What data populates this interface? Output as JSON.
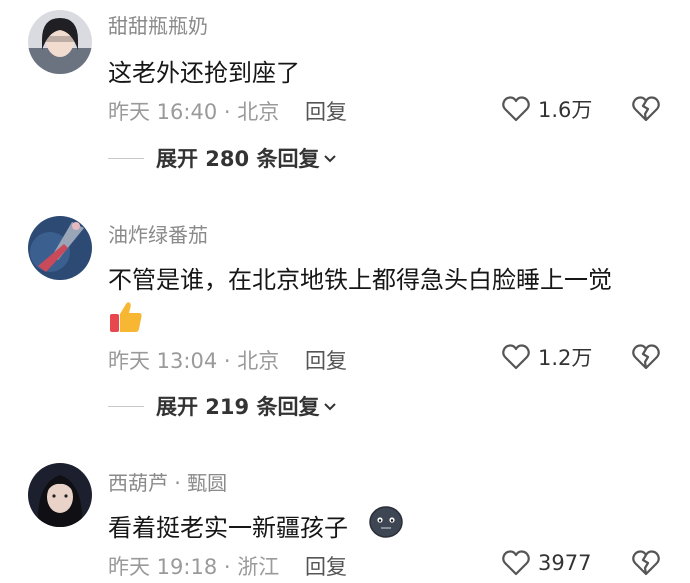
{
  "comments": [
    {
      "username": "甜甜瓶瓶奶",
      "text": "这老外还抢到座了",
      "meta": "昨天 16:40 · 北京",
      "reply_label": "回复",
      "likes": "1.6万",
      "expand_label": "展开 280 条回复"
    },
    {
      "username": "油炸绿番茄",
      "text": "不管是谁，在北京地铁上都得急头白脸睡上一觉",
      "emoji": "thumbs-up-icon",
      "meta": "昨天 13:04 · 北京",
      "reply_label": "回复",
      "likes": "1.2万",
      "expand_label": "展开 219 条回复"
    },
    {
      "username": "西葫芦 · 甄圆",
      "text": "看着挺老实一新疆孩子",
      "emoji": "blank-face-icon",
      "meta": "昨天 19:18 · 浙江",
      "reply_label": "回复",
      "likes": "3977"
    }
  ],
  "colors": {
    "username": "#8a8a8a",
    "text": "#161616",
    "meta": "#9a9a9a"
  }
}
